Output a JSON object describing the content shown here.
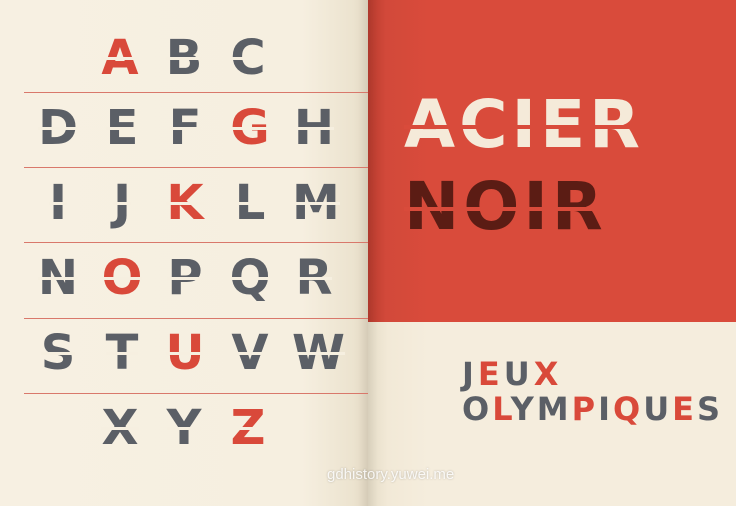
{
  "alphabet": {
    "rows": [
      [
        {
          "ch": "A",
          "color": "red"
        },
        {
          "ch": "B",
          "color": "gray"
        },
        {
          "ch": "C",
          "color": "gray"
        }
      ],
      [
        {
          "ch": "D",
          "color": "gray"
        },
        {
          "ch": "E",
          "color": "gray"
        },
        {
          "ch": "F",
          "color": "gray"
        },
        {
          "ch": "G",
          "color": "red"
        },
        {
          "ch": "H",
          "color": "gray"
        }
      ],
      [
        {
          "ch": "I",
          "color": "gray"
        },
        {
          "ch": "J",
          "color": "gray"
        },
        {
          "ch": "K",
          "color": "red"
        },
        {
          "ch": "L",
          "color": "gray"
        },
        {
          "ch": "M",
          "color": "gray"
        }
      ],
      [
        {
          "ch": "N",
          "color": "gray"
        },
        {
          "ch": "O",
          "color": "red"
        },
        {
          "ch": "P",
          "color": "gray"
        },
        {
          "ch": "Q",
          "color": "gray"
        },
        {
          "ch": "R",
          "color": "gray"
        }
      ],
      [
        {
          "ch": "S",
          "color": "gray"
        },
        {
          "ch": "T",
          "color": "gray"
        },
        {
          "ch": "U",
          "color": "red"
        },
        {
          "ch": "V",
          "color": "gray"
        },
        {
          "ch": "W",
          "color": "gray"
        }
      ],
      [
        {
          "ch": "X",
          "color": "gray"
        },
        {
          "ch": "Y",
          "color": "gray"
        },
        {
          "ch": "Z",
          "color": "red"
        }
      ]
    ]
  },
  "title": {
    "line1": "ACIER",
    "line2": "NOIR"
  },
  "subtitle": {
    "line1": "JEUX",
    "line2": "OLYMPIQUES"
  },
  "watermark": "gdhistory.yuwei.me",
  "colors": {
    "red": "#d9493a",
    "gray": "#5b5f66",
    "cream": "#f6efe0",
    "dark_red": "#5b1c14"
  }
}
